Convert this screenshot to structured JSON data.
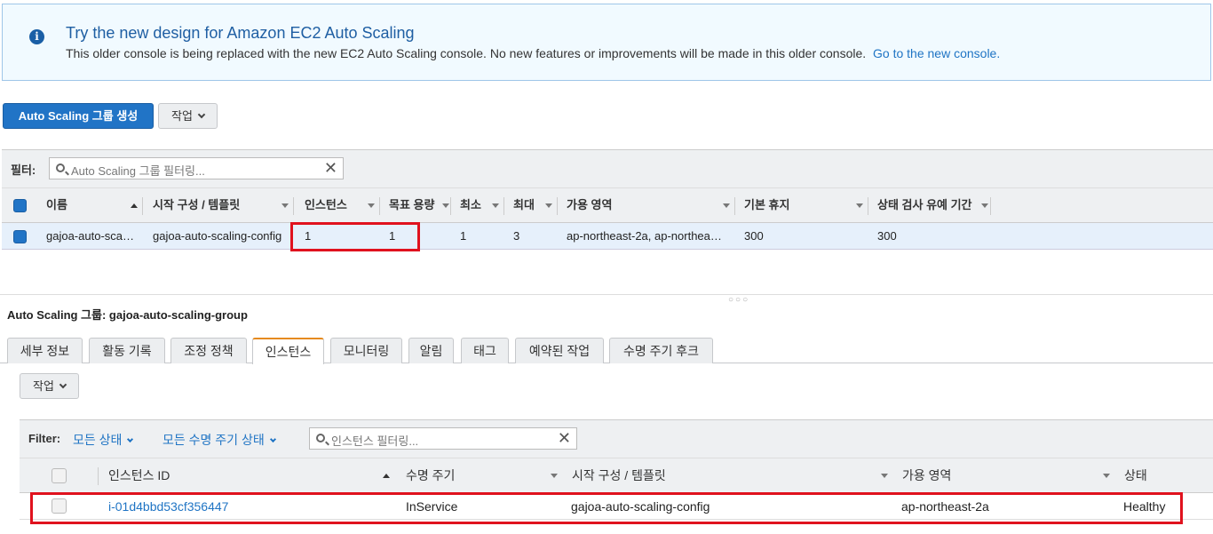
{
  "banner": {
    "title": "Try the new design for Amazon EC2 Auto Scaling",
    "text": "This older console is being replaced with the new EC2 Auto Scaling console. No new features or improvements will be made in this older console.",
    "link": "Go to the new console."
  },
  "toolbar": {
    "create_label": "Auto Scaling 그룹 생성",
    "actions_label": "작업"
  },
  "group_filter": {
    "label": "필터:",
    "placeholder": "Auto Scaling 그룹 필터링..."
  },
  "group_table": {
    "columns": [
      "이름",
      "시작 구성 / 템플릿",
      "인스턴스",
      "목표 용량",
      "최소",
      "최대",
      "가용 영역",
      "기본 휴지",
      "상태 검사 유예 기간"
    ],
    "row": {
      "name": "gajoa-auto-sca…",
      "launch_config": "gajoa-auto-scaling-config",
      "instances": "1",
      "desired": "1",
      "min": "1",
      "max": "3",
      "azs": "ap-northeast-2a, ap-northea…",
      "cooldown": "300",
      "grace": "300"
    }
  },
  "detail": {
    "title": "Auto Scaling 그룹: gajoa-auto-scaling-group",
    "tabs": [
      "세부 정보",
      "활동 기록",
      "조정 정책",
      "인스턴스",
      "모니터링",
      "알림",
      "태그",
      "예약된 작업",
      "수명 주기 후크"
    ],
    "active_tab": "인스턴스",
    "actions_label": "작업"
  },
  "instance_filter": {
    "label": "Filter:",
    "state_drop": "모든 상태",
    "lifecycle_drop": "모든 수명 주기 상태",
    "placeholder": "인스턴스 필터링..."
  },
  "instance_table": {
    "columns": [
      "인스턴스 ID",
      "수명 주기",
      "시작 구성 / 템플릿",
      "가용 영역",
      "상태"
    ],
    "row": {
      "id": "i-01d4bbd53cf356447",
      "lifecycle": "InService",
      "launch_config": "gajoa-auto-scaling-config",
      "az": "ap-northeast-2a",
      "health": "Healthy"
    }
  },
  "colors": {
    "primary": "#2174c6",
    "highlight": "#e0121e",
    "active_tab": "#e58a1f"
  }
}
